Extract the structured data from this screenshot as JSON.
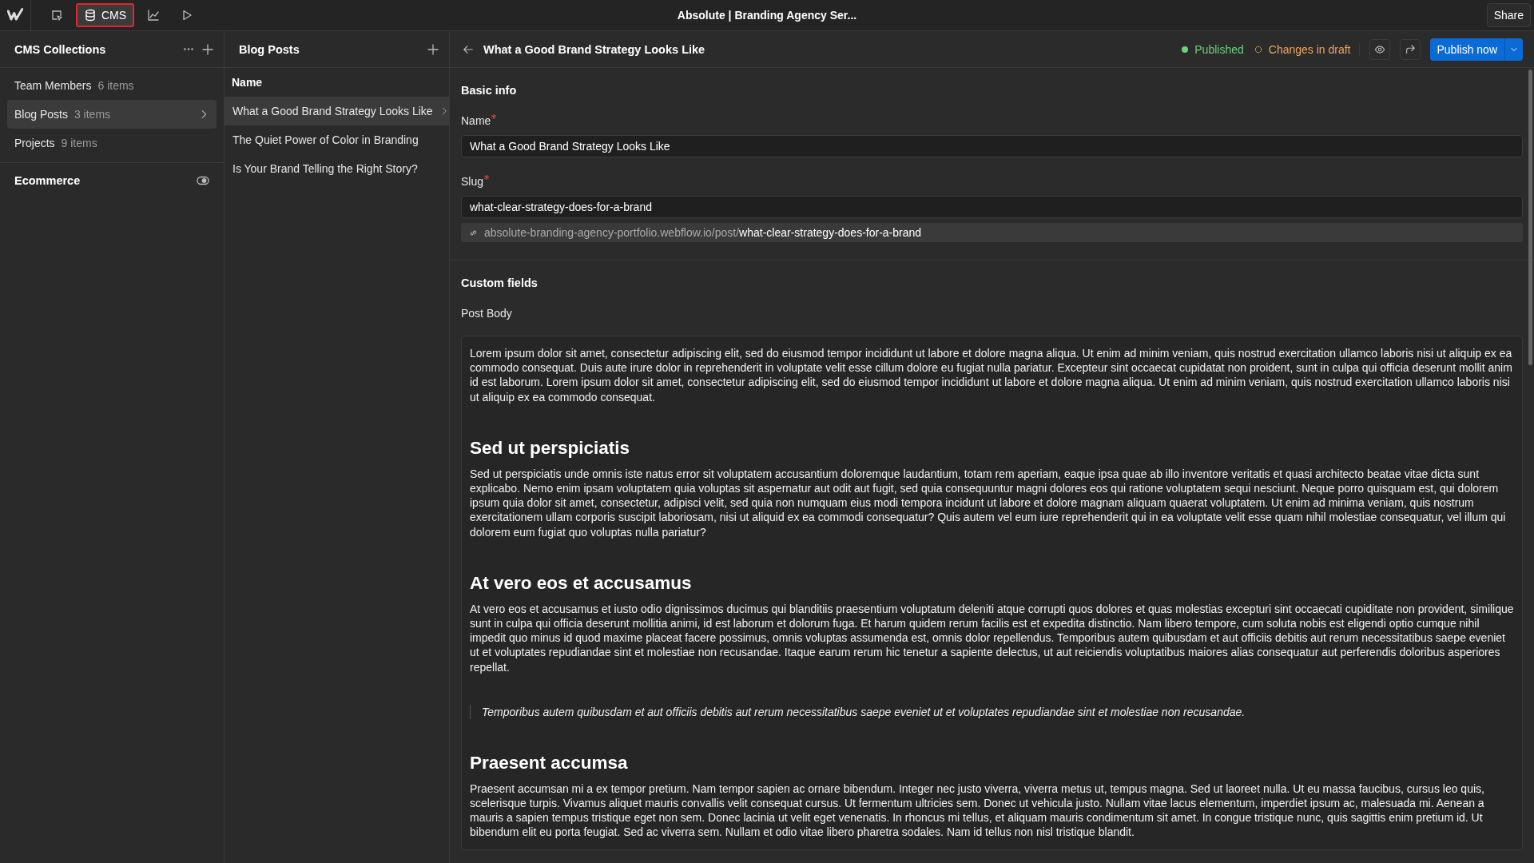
{
  "topbar": {
    "tools": [
      {
        "kind": "pointer",
        "selected": false
      },
      {
        "kind": "cms",
        "label": "CMS",
        "selected": true
      },
      {
        "kind": "chart",
        "selected": false
      },
      {
        "kind": "play",
        "selected": false
      }
    ],
    "title": "Absolute | Branding Agency Ser...",
    "share": "Share"
  },
  "collections": {
    "title": "CMS Collections",
    "items": [
      {
        "name": "Team Members",
        "count": "6 items",
        "selected": false
      },
      {
        "name": "Blog Posts",
        "count": "3 items",
        "selected": true
      },
      {
        "name": "Projects",
        "count": "9 items",
        "selected": false
      }
    ],
    "ecommerce": {
      "label": "Ecommerce"
    }
  },
  "posts": {
    "title": "Blog Posts",
    "column": "Name",
    "rows": [
      {
        "name": "What a Good Brand Strategy Looks Like",
        "selected": true
      },
      {
        "name": "The Quiet Power of Color in Branding",
        "selected": false
      },
      {
        "name": "Is Your Brand Telling the Right Story?",
        "selected": false
      }
    ]
  },
  "editor": {
    "title": "What a Good Brand Strategy Looks Like",
    "status": {
      "published": "Published",
      "draft": "Changes in draft"
    },
    "publish": "Publish now",
    "basic_info": "Basic info",
    "name_field": {
      "label": "Name",
      "required": true,
      "value": "What a Good Brand Strategy Looks Like"
    },
    "slug_field": {
      "label": "Slug",
      "required": true,
      "value": "what-clear-strategy-does-for-a-brand"
    },
    "url": {
      "base": "absolute-branding-agency-portfolio.webflow.io/post/",
      "slug": "what-clear-strategy-does-for-a-brand"
    },
    "custom_fields": "Custom fields",
    "body_label": "Post Body",
    "body": [
      {
        "kind": "paragraph",
        "text": "Lorem ipsum dolor sit amet, consectetur adipiscing elit, sed do eiusmod tempor incididunt ut labore et dolore magna aliqua. Ut enim ad minim veniam, quis nostrud exercitation ullamco laboris nisi ut aliquip ex ea commodo consequat. Duis aute irure dolor in reprehenderit in voluptate velit esse cillum dolore eu fugiat nulla pariatur. Excepteur sint occaecat cupidatat non proident, sunt in culpa qui officia deserunt mollit anim id est laborum. Lorem ipsum dolor sit amet, consectetur adipiscing elit, sed do eiusmod tempor incididunt ut labore et dolore magna aliqua. Ut enim ad minim veniam, quis nostrud exercitation ullamco laboris nisi ut aliquip ex ea commodo consequat."
      },
      {
        "kind": "heading",
        "text": "Sed ut perspiciatis"
      },
      {
        "kind": "paragraph",
        "text": "Sed ut perspiciatis unde omnis iste natus error sit voluptatem accusantium doloremque laudantium, totam rem aperiam, eaque ipsa quae ab illo inventore veritatis et quasi architecto beatae vitae dicta sunt explicabo. Nemo enim ipsam voluptatem quia voluptas sit aspernatur aut odit aut fugit, sed quia consequuntur magni dolores eos qui ratione voluptatem sequi nesciunt. Neque porro quisquam est, qui dolorem ipsum quia dolor sit amet, consectetur, adipisci velit, sed quia non numquam eius modi tempora incidunt ut labore et dolore magnam aliquam quaerat voluptatem. Ut enim ad minima veniam, quis nostrum exercitationem ullam corporis suscipit laboriosam, nisi ut aliquid ex ea commodi consequatur? Quis autem vel eum iure reprehenderit qui in ea voluptate velit esse quam nihil molestiae consequatur, vel illum qui dolorem eum fugiat quo voluptas nulla pariatur?"
      },
      {
        "kind": "heading",
        "text": "At vero eos et accusamus"
      },
      {
        "kind": "paragraph",
        "text": "At vero eos et accusamus et iusto odio dignissimos ducimus qui blanditiis praesentium voluptatum deleniti atque corrupti quos dolores et quas molestias excepturi sint occaecati cupiditate non provident, similique sunt in culpa qui officia deserunt mollitia animi, id est laborum et dolorum fuga. Et harum quidem rerum facilis est et expedita distinctio. Nam libero tempore, cum soluta nobis est eligendi optio cumque nihil impedit quo minus id quod maxime placeat facere possimus, omnis voluptas assumenda est, omnis dolor repellendus. Temporibus autem quibusdam et aut officiis debitis aut rerum necessitatibus saepe eveniet ut et voluptates repudiandae sint et molestiae non recusandae. Itaque earum rerum hic tenetur a sapiente delectus, ut aut reiciendis voluptatibus maiores alias consequatur aut perferendis doloribus asperiores repellat."
      },
      {
        "kind": "quote",
        "text": "Temporibus autem quibusdam et aut officiis debitis aut rerum necessitatibus saepe eveniet ut et voluptates repudiandae sint et molestiae non recusandae."
      },
      {
        "kind": "heading",
        "text": "Praesent accumsa"
      },
      {
        "kind": "paragraph",
        "text": "Praesent accumsan mi a ex tempor pretium. Nam tempor sapien ac ornare bibendum. Integer nec justo viverra, viverra metus ut, tempus magna. Sed ut laoreet nulla. Ut eu massa faucibus, cursus leo quis, scelerisque turpis. Vivamus aliquet mauris convallis velit consequat cursus. Ut fermentum ultricies sem. Donec ut vehicula justo. Nullam vitae lacus elementum, imperdiet ipsum ac, malesuada mi. Aenean a mauris a sapien tempus tristique eget non sem. Donec lacinia ut velit eget venenatis. In rhoncus mi tellus, et aliquam mauris condimentum sit amet. In congue tristique nunc, quis sagittis enim pretium id. Ut bibendum elit eu porta feugiat. Sed ac viverra sem. Nullam et odio vitae libero pharetra sodales. Nam id tellus non nisl tristique blandit."
      }
    ]
  }
}
